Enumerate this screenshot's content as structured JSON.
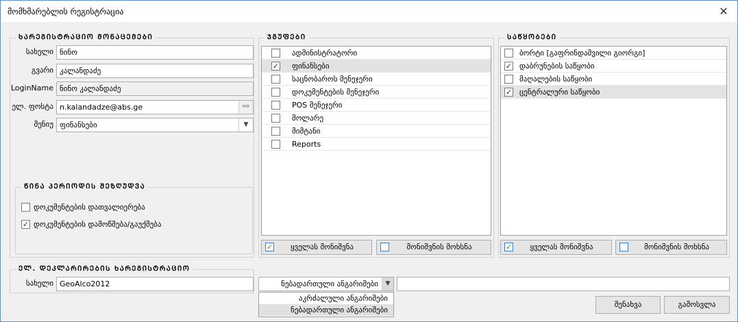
{
  "window": {
    "title": "მომხმარებლის რეგისტრაცია"
  },
  "registration": {
    "title": "ᲮᲐᲠᲔᲒᲘᲡᲢᲠᲐᲪᲘᲝ ᲛᲝᲜᲐᲪᲔᲛᲔᲑᲘ",
    "name_label": "სახელი",
    "name_value": "ნინო",
    "surname_label": "გვარი",
    "surname_value": "კალანდაძე",
    "login_label": "LoginName",
    "login_value": "ნინო კალანდაძე",
    "email_label": "ელ. ფოსტა",
    "email_value": "n.kalandadze@abs.ge",
    "menu_label": "მენიუ",
    "menu_value": "ფინანსები"
  },
  "restriction": {
    "title": "ᲬᲘᲜᲐ ᲞᲔᲠᲘᲝᲓᲘᲡ ᲨᲔᲖᲦᲣᲓᲕᲐ",
    "items": [
      {
        "label": "დოკუმენტების დათვალიერება",
        "checked": false
      },
      {
        "label": "დოკუმენტების დამოწმება/გაუქმება",
        "checked": true
      }
    ]
  },
  "groups": {
    "title": "ᲯᲒᲣᲤᲔᲑᲘ",
    "items": [
      {
        "label": "ადმინისტრატორი",
        "checked": false
      },
      {
        "label": "ფინანსები",
        "checked": true
      },
      {
        "label": "საცნობაროს მენეჯერი",
        "checked": false
      },
      {
        "label": "დოკუმენტების მენეჯერი",
        "checked": false
      },
      {
        "label": "POS მენეჯერი",
        "checked": false
      },
      {
        "label": "მოლარე",
        "checked": false
      },
      {
        "label": "მიმტანი",
        "checked": false
      },
      {
        "label": "Reports",
        "checked": false
      }
    ],
    "select_all": "ყველას მონიშვნა",
    "clear_all": "მონიშვნის მოხსნა"
  },
  "warehouses": {
    "title": "ᲡᲐᲬᲧᲝᲑᲔᲑᲘ",
    "items": [
      {
        "label": "ბორტი  [გაფრინდაშვილი გიორგი]",
        "checked": false
      },
      {
        "label": "დაბრუნების საწყობი",
        "checked": true
      },
      {
        "label": "მაღალების საწყობი",
        "checked": false
      },
      {
        "label": "ცენტრალური საწყობი",
        "checked": true
      }
    ],
    "select_all": "ყველას მონიშვნა",
    "clear_all": "მონიშვნის მოხსნა"
  },
  "edeclaration": {
    "title": "ᲔᲚ. ᲓᲔᲙᲚᲐᲠᲘᲠᲔᲑᲘᲡ ᲮᲐᲠᲔᲒᲘᲡᲢᲠᲐᲪᲘᲝ",
    "name_label": "სახელი",
    "name_value": "GeoAlco2012"
  },
  "account_type": {
    "selected": "ნებადართული ანგარიშები",
    "options": [
      "აკრძალული ანგარიშები",
      "ნებადართული ანგარიშები"
    ]
  },
  "footer": {
    "save_label": "შენახვა",
    "exit_label": "გამოსვლა",
    "extra_value": ""
  }
}
